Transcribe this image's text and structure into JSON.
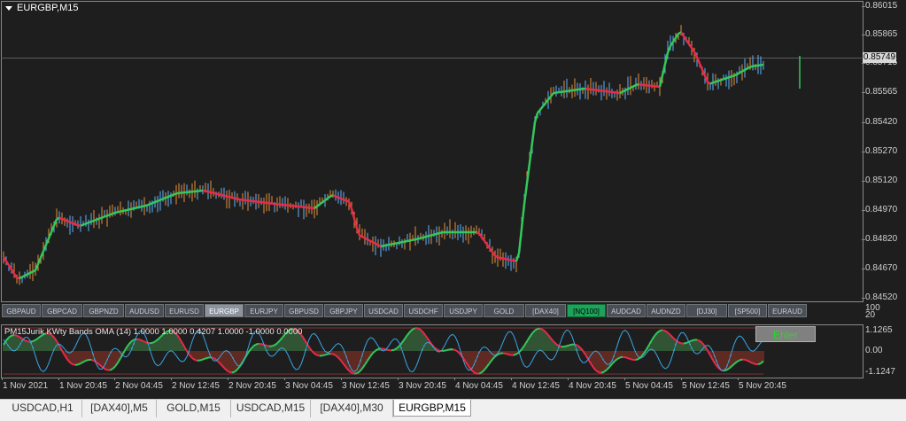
{
  "chart": {
    "symbol_title": "EURGBP,M15",
    "current_price": "0.85749",
    "price_labels": [
      "0.86015",
      "0.85865",
      "0.85715",
      "0.85565",
      "0.85420",
      "0.85270",
      "0.85120",
      "0.84970",
      "0.84820",
      "0.84670",
      "0.84520"
    ],
    "sub_axis_labels": {
      "top_100": "100",
      "top_20": "20",
      "upper": "1.1265",
      "mid": "0.00",
      "lower": "-1.1247"
    },
    "sub_indicator_title": "PM15Jurik KWty Bands OMA (14) 1.0000 1.0000 0.4207 1.0000 -1.0000 0.0000",
    "indicator_button": "Ehler",
    "time_labels": [
      "1 Nov 2021",
      "1 Nov 20:45",
      "2 Nov 04:45",
      "2 Nov 12:45",
      "2 Nov 20:45",
      "3 Nov 04:45",
      "3 Nov 12:45",
      "3 Nov 20:45",
      "4 Nov 04:45",
      "4 Nov 12:45",
      "4 Nov 20:45",
      "5 Nov 04:45",
      "5 Nov 12:45",
      "5 Nov 20:45"
    ],
    "colors": {
      "up": "#5fb3ff",
      "down": "#e8903a",
      "ma_up": "#32c85a",
      "ma_down": "#e8294a"
    }
  },
  "symbol_buttons": [
    {
      "label": "GBPAUD"
    },
    {
      "label": "GBPCAD"
    },
    {
      "label": "GBPNZD"
    },
    {
      "label": "AUDUSD"
    },
    {
      "label": "EURUSD"
    },
    {
      "label": "EURGBP",
      "state": "active"
    },
    {
      "label": "EURJPY"
    },
    {
      "label": "GBPUSD"
    },
    {
      "label": "GBPJPY"
    },
    {
      "label": "USDCAD"
    },
    {
      "label": "USDCHF"
    },
    {
      "label": "USDJPY"
    },
    {
      "label": "GOLD"
    },
    {
      "label": "[DAX40]"
    },
    {
      "label": "[NQ100]",
      "state": "green"
    },
    {
      "label": "AUDCAD"
    },
    {
      "label": "AUDNZD"
    },
    {
      "label": "[DJ30]"
    },
    {
      "label": "[SP500]"
    },
    {
      "label": "EURAUD"
    }
  ],
  "tabs": [
    {
      "label": "USDCAD,H1"
    },
    {
      "label": "[DAX40],M5"
    },
    {
      "label": "GOLD,M15"
    },
    {
      "label": "USDCAD,M15"
    },
    {
      "label": "[DAX40],M30"
    },
    {
      "label": "EURGBP,M15",
      "active": true
    }
  ]
}
